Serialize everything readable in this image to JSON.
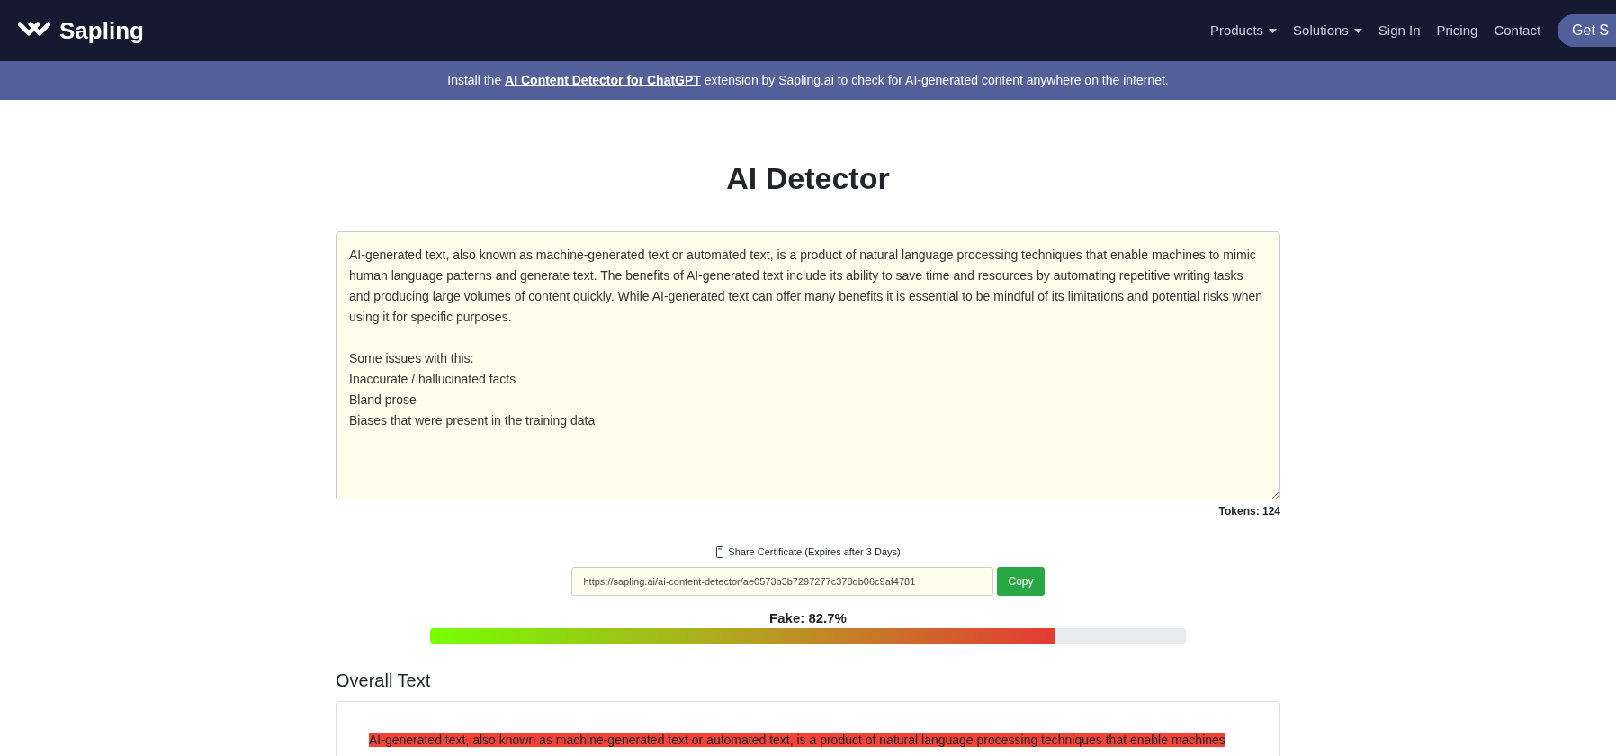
{
  "nav": {
    "brand": "Sapling",
    "items": [
      {
        "label": "Products",
        "dropdown": true
      },
      {
        "label": "Solutions",
        "dropdown": true
      },
      {
        "label": "Sign In",
        "dropdown": false
      },
      {
        "label": "Pricing",
        "dropdown": false
      },
      {
        "label": "Contact",
        "dropdown": false
      }
    ],
    "cta": "Get S"
  },
  "banner": {
    "before": "Install the",
    "link": "AI Content Detector for ChatGPT",
    "after": "extension by Sapling.ai to check for AI-generated content anywhere on the internet."
  },
  "title": "AI Detector",
  "input": {
    "value": "AI-generated text, also known as machine-generated text or automated text, is a product of natural language processing techniques that enable machines to mimic human language patterns and generate text. The benefits of AI-generated text include its ability to save time and resources by automating repetitive writing tasks and producing large volumes of content quickly. While AI-generated text can offer many benefits it is essential to be mindful of its limitations and potential risks when using it for specific purposes.\n\nSome issues with this:\nInaccurate / hallucinated facts\nBland prose\nBiases that were present in the training data",
    "tokens": "Tokens: 124"
  },
  "share": {
    "label": "Share Certificate (Expires after 3 Days)",
    "url": "https://sapling.ai/ai-content-detector/ae0573b3b7297277c378db06c9af4781",
    "button": "Copy"
  },
  "score": {
    "label": "Fake: 82.7%",
    "level": 0.827
  },
  "overall": {
    "heading": "Overall Text",
    "sentences": [
      {
        "text": "AI-generated text, also known as machine-generated text or automated text, is a product of natural language processing techniques that enable machines",
        "color": "#f44336"
      }
    ]
  }
}
